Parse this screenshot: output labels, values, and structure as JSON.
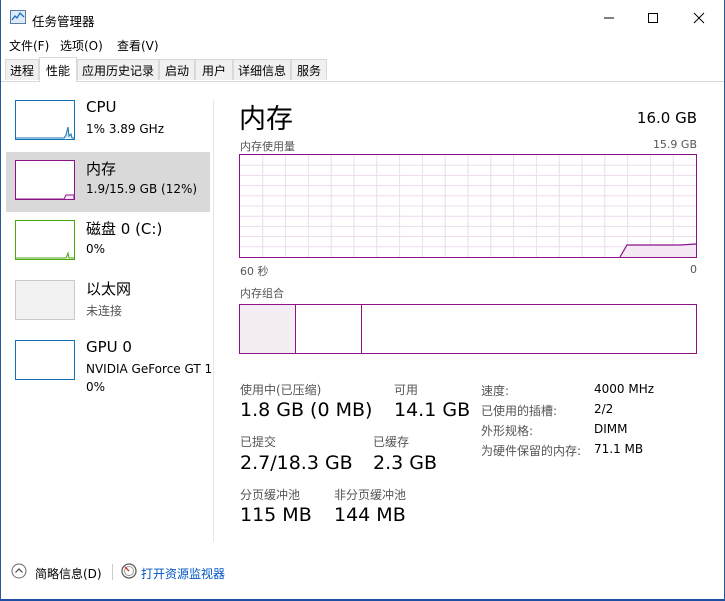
{
  "window": {
    "title": "任务管理器",
    "minimize": "—",
    "maximize": "☐",
    "close": "✕"
  },
  "menu": [
    "文件(F)",
    "选项(O)",
    "查看(V)"
  ],
  "tabs": [
    {
      "label": "进程",
      "active": false
    },
    {
      "label": "性能",
      "active": true
    },
    {
      "label": "应用历史记录",
      "active": false
    },
    {
      "label": "启动",
      "active": false
    },
    {
      "label": "用户",
      "active": false
    },
    {
      "label": "详细信息",
      "active": false
    },
    {
      "label": "服务",
      "active": false
    }
  ],
  "sidebar": {
    "items": [
      {
        "title": "CPU",
        "sub": "1% 3.89 GHz",
        "sub2": "",
        "color": "#1171b5",
        "selected": false
      },
      {
        "title": "内存",
        "sub": "1.9/15.9 GB (12%)",
        "sub2": "",
        "color": "#8b1289",
        "selected": true
      },
      {
        "title": "磁盘 0 (C:)",
        "sub": "0%",
        "sub2": "",
        "color": "#4da60c",
        "selected": false
      },
      {
        "title": "以太网",
        "sub": "未连接",
        "sub2": "",
        "color": "#a0a0a0",
        "selected": false
      },
      {
        "title": "GPU 0",
        "sub": "NVIDIA GeForce GT 1",
        "sub2": "0%",
        "color": "#1171b5",
        "selected": false
      }
    ]
  },
  "main": {
    "title": "内存",
    "total": "16.0 GB",
    "usage_label": "内存使用量",
    "usage_max": "15.9 GB",
    "time_left": "60 秒",
    "time_right": "0",
    "composition_label": "内存组合",
    "accent_color": "#8b1289",
    "stats": {
      "in_use_label": "使用中(已压缩)",
      "in_use_value": "1.8 GB (0 MB)",
      "available_label": "可用",
      "available_value": "14.1 GB",
      "committed_label": "已提交",
      "committed_value": "2.7/18.3 GB",
      "cached_label": "已缓存",
      "cached_value": "2.3 GB",
      "paged_label": "分页缓冲池",
      "paged_value": "115 MB",
      "nonpaged_label": "非分页缓冲池",
      "nonpaged_value": "144 MB"
    },
    "specs": [
      {
        "label": "速度:",
        "value": "4000 MHz"
      },
      {
        "label": "已使用的插槽:",
        "value": "2/2"
      },
      {
        "label": "外形规格:",
        "value": "DIMM"
      },
      {
        "label": "为硬件保留的内存:",
        "value": "71.1 MB"
      }
    ]
  },
  "footer": {
    "less_details": "简略信息(D)",
    "open_monitor": "打开资源监视器"
  }
}
